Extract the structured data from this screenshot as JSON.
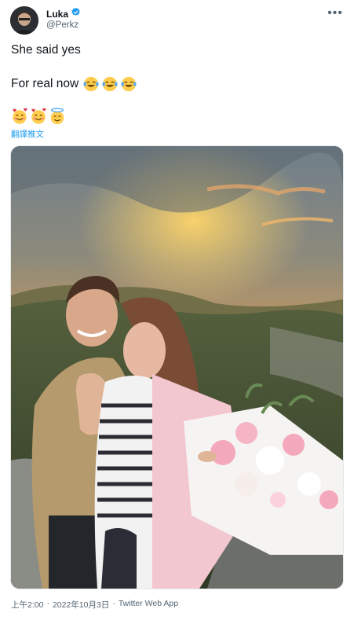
{
  "user": {
    "name": "Luka",
    "handle": "@Perkz"
  },
  "tweet": {
    "line1": "She said yes",
    "line2": "For real now",
    "line2_emojis": [
      "face-with-tears-of-joy",
      "face-with-tears-of-joy",
      "face-with-tears-of-joy"
    ],
    "line3_emojis": [
      "smiling-face-with-hearts",
      "smiling-face-with-hearts",
      "smiling-face-with-halo"
    ],
    "translate_label": "翻譯推文"
  },
  "meta": {
    "time": "上午2:00",
    "separator1": "·",
    "date": "2022年10月3日",
    "separator2": "·",
    "app": "Twitter Web App"
  },
  "colors": {
    "link": "#1d9bf0",
    "secondary_text": "#536471",
    "primary_text": "#0f1419"
  }
}
